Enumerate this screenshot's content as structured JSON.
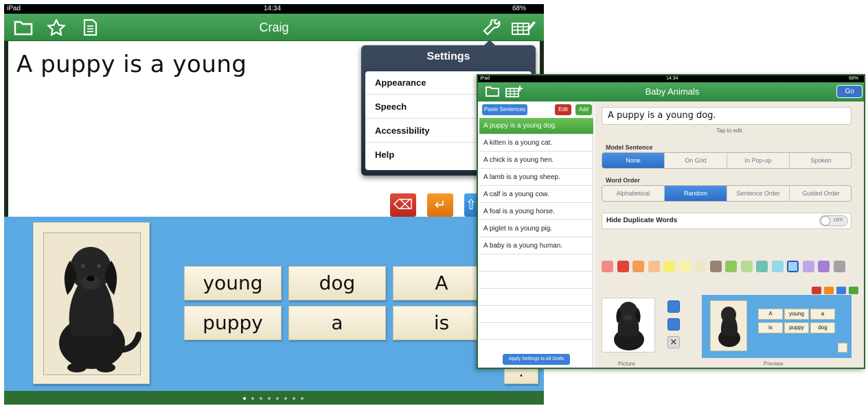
{
  "left_device": {
    "status": {
      "carrier": "iPad",
      "time": "14:34",
      "battery": "68%"
    },
    "title": "Craig",
    "sentence": "A puppy is a young",
    "popover": {
      "title": "Settings",
      "items": [
        "Appearance",
        "Speech",
        "Accessibility",
        "Help"
      ]
    },
    "words": [
      "young",
      "dog",
      "A",
      "puppy",
      "a",
      "is"
    ],
    "period": ".",
    "page_count": 8,
    "active_page": 1,
    "icons": [
      "folder-icon",
      "star-icon",
      "document-icon",
      "wrench-icon",
      "grid-edit-icon",
      "backspace-icon",
      "return-icon",
      "shift-icon"
    ]
  },
  "right_device": {
    "status": {
      "carrier": "iPad",
      "time": "14:34",
      "battery": "68%"
    },
    "title": "Baby Animals",
    "go_label": "Go",
    "paste_label": "Paste Sentences",
    "edit_label": "Edit",
    "add_label": "Add",
    "sentences": [
      "A puppy is a young dog.",
      "A kitten is a young cat.",
      "A chick is a young hen.",
      "A lamb is a young sheep.",
      "A calf is a young cow.",
      "A foal is a young horse.",
      "A piglet is a young pig.",
      "A baby is a young human."
    ],
    "selected_index": 0,
    "apply_label": "Apply Settings to All Grids",
    "current_sentence": "A puppy is a young dog.",
    "tap_hint": "Tap to edit.",
    "model_sentence": {
      "label": "Model Sentence",
      "options": [
        "None",
        "On Grid",
        "In Pop-up",
        "Spoken"
      ],
      "selected": "None"
    },
    "word_order": {
      "label": "Word Order",
      "options": [
        "Alphabetical",
        "Random",
        "Sentence Order",
        "Guided Order"
      ],
      "selected": "Random"
    },
    "hide_duplicates": {
      "label": "Hide Duplicate Words",
      "state": "OFF"
    },
    "colors": [
      "#f08a84",
      "#e0453a",
      "#f49b52",
      "#f7c08f",
      "#f6ef6e",
      "#f8f3a6",
      "#efe7c7",
      "#9a8272",
      "#8bc860",
      "#b6dc97",
      "#6fc1b4",
      "#92dbe8",
      "#9fd0f6",
      "#bfa6e8",
      "#a57fd6",
      "#a3a3a3"
    ],
    "selected_color_index": 12,
    "preview_words": [
      "A",
      "young",
      "a",
      "is",
      "puppy",
      "dog"
    ],
    "picture_caption": "Picture",
    "preview_caption": "Preview"
  }
}
